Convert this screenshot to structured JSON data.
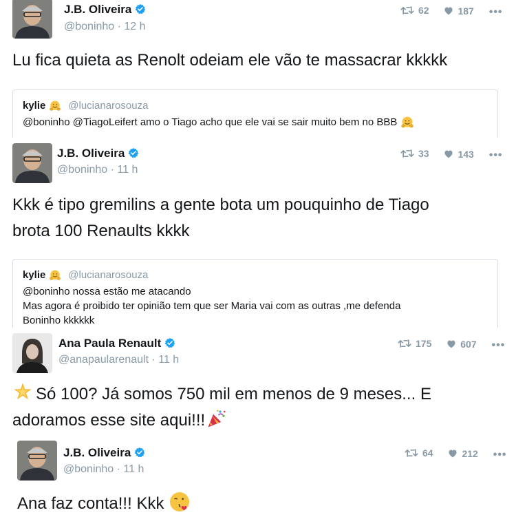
{
  "tweets": [
    {
      "name": "J.B. Oliveira",
      "handle": "@boninho",
      "time": "12 h",
      "retweets": "62",
      "likes": "187",
      "text": "Lu fica quieta as Renolt odeiam ele vão te massacrar kkkkk",
      "quote": {
        "name": "kylie",
        "handle": "@lucianarosouza",
        "text": "@boninho @TiagoLeifert amo o Tiago acho que ele vai se sair muito bem  no BBB"
      }
    },
    {
      "name": "J.B. Oliveira",
      "handle": "@boninho",
      "time": "11 h",
      "retweets": "33",
      "likes": "143",
      "text_line1": "Kkk é tipo gremilins a gente bota um pouquinho de Tiago",
      "text_line2": "brota 100 Renaults kkkk",
      "quote": {
        "name": "kylie",
        "handle": "@lucianarosouza",
        "line1": "@boninho nossa estão me atacando",
        "line2": "Mas agora é proibido ter opinião tem que ser Maria vai com as outras ,me defenda",
        "line3": "Boninho kkkkkk"
      }
    },
    {
      "name": "Ana Paula Renault",
      "handle": "@anapaularenault",
      "time": "11 h",
      "retweets": "175",
      "likes": "607",
      "text_line1": "Só 100? Já somos 750 mil em menos de 9 meses... E",
      "text_line2": "adoramos esse site aqui!!!"
    },
    {
      "name": "J.B. Oliveira",
      "handle": "@boninho",
      "time": "11 h",
      "retweets": "64",
      "likes": "212",
      "text": "Ana faz conta!!! Kkk"
    }
  ],
  "separator": " · ",
  "more_label": "•••",
  "colors": {
    "muted": "#8899a6",
    "verified": "#1da1f2",
    "text": "#14171a",
    "border": "#d8dee3"
  },
  "icons": [
    "retweet-icon",
    "heart-icon",
    "more-icon",
    "verified-icon",
    "hugging-emoji",
    "star-emoji",
    "party-popper-emoji",
    "kiss-emoji"
  ]
}
